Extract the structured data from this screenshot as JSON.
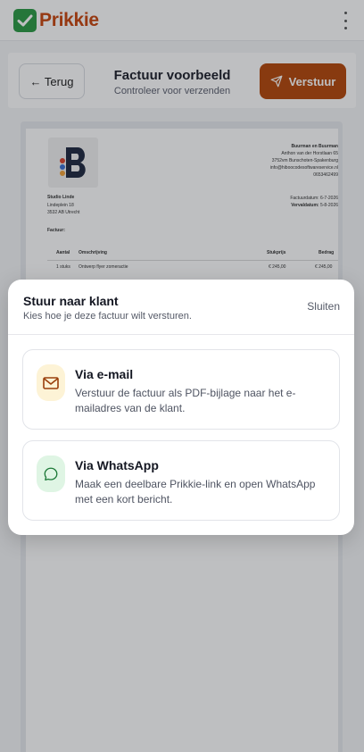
{
  "app": {
    "brand": "Prikkie",
    "brand_color": "#c8460e",
    "check_color": "#2c9a45"
  },
  "toolbar": {
    "back_label": "← Terug",
    "title": "Factuur voorbeeld",
    "subtitle": "Controleer voor verzenden",
    "send_label": "Verstuur",
    "send_color": "#b4470b"
  },
  "invoice": {
    "company": {
      "name": "Buurman en Buurman",
      "lines": [
        "Anthon van der Horstlaan 65",
        "3752vm Bunschoten-Spakenburg",
        "info@hiboocodesoftwareservice.nl",
        "0653462499"
      ]
    },
    "client": {
      "name": "Studio Linde",
      "lines": [
        "Lindeplein 18",
        "3532 AB Utrecht"
      ]
    },
    "dates": [
      {
        "label": "Factuurdatum:",
        "value": "6-7-2026"
      },
      {
        "label": "Vervaldatum:",
        "value": "5-8-2026"
      }
    ],
    "invoice_label": "Factuur:",
    "columns": {
      "qty": "Aantal",
      "desc": "Omschrijving",
      "price": "Stukprijs",
      "amount": "Bedrag"
    },
    "rows": [
      {
        "qty": "1 stuks",
        "desc": "Ontwerp flyer zomeractie",
        "price": "€ 245,00",
        "amount": "€ 245,00"
      }
    ]
  },
  "sheet": {
    "title": "Stuur naar klant",
    "subtitle": "Kies hoe je deze factuur wilt versturen.",
    "close_label": "Sluiten",
    "options": [
      {
        "title": "Via e-mail",
        "description": "Verstuur de factuur als PDF-bijlage naar het e-mailadres van de klant.",
        "icon": "mail-icon",
        "icon_bg": "#fdf3d6",
        "icon_color": "#9a3f0c"
      },
      {
        "title": "Via WhatsApp",
        "description": "Maak een deelbare Prikkie-link en open WhatsApp met een kort bericht.",
        "icon": "whatsapp-icon",
        "icon_bg": "#dff5e4",
        "icon_color": "#1e7a39"
      }
    ]
  }
}
